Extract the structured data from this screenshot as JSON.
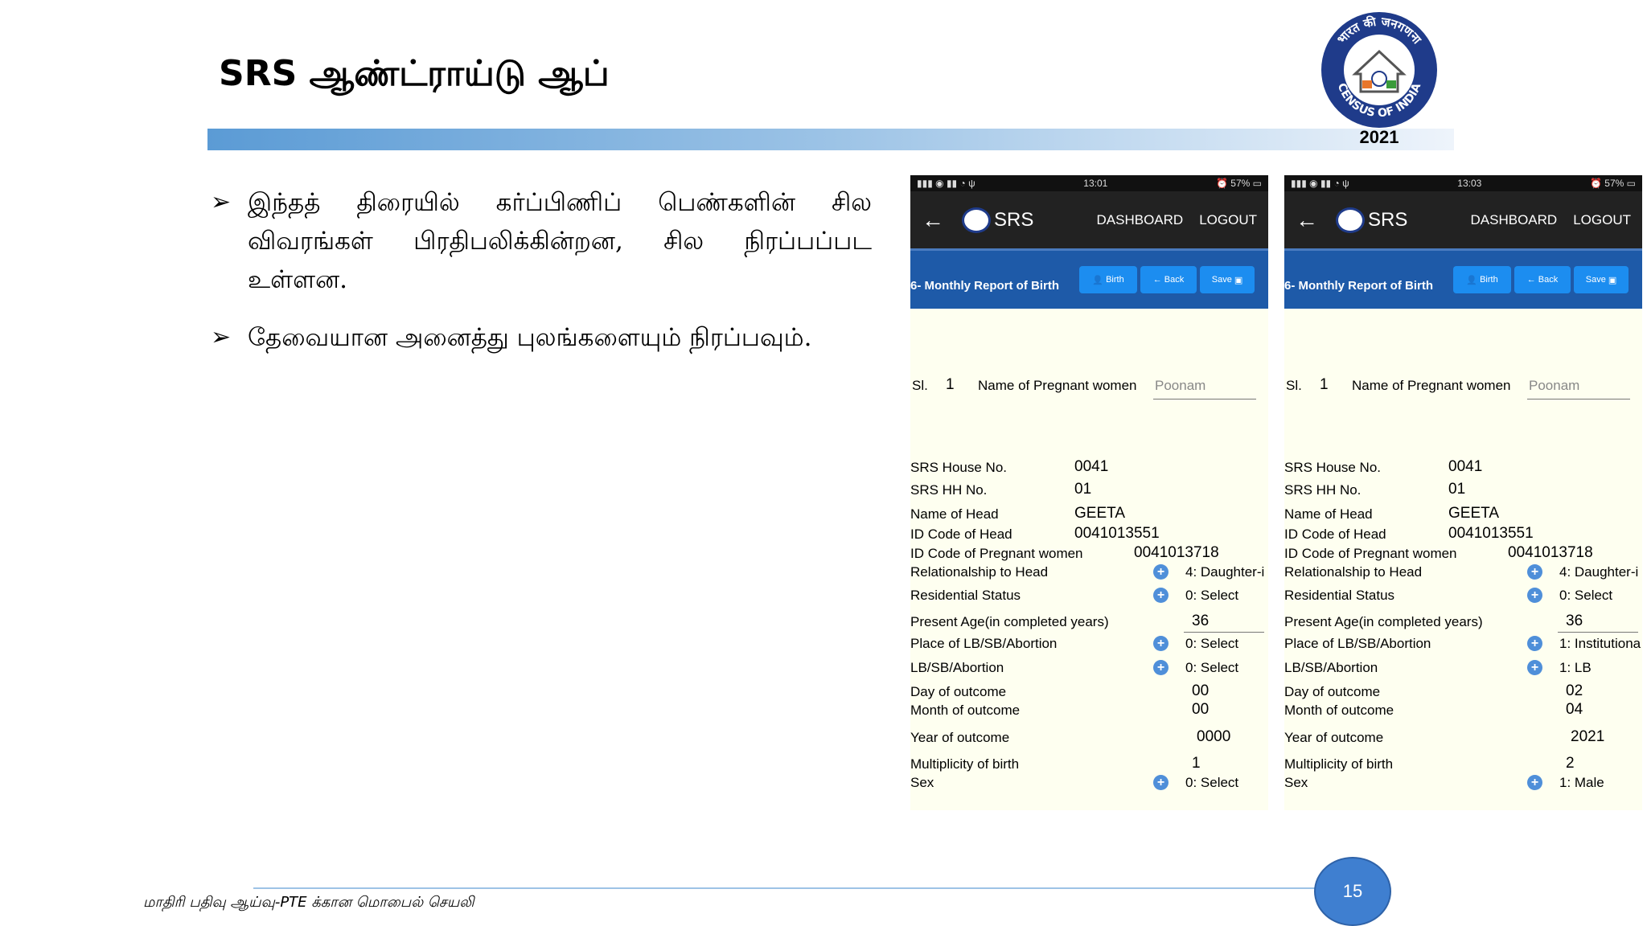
{
  "slide": {
    "title": "SRS ஆண்ட்ராய்டு ஆப்",
    "bullets": [
      "இந்தத் திரையில் கர்ப்பிணிப் பெண்களின் சில விவரங்கள் பிரதிபலிக்கின்றன, சில நிரப்பப்பட உள்ளன.",
      "தேவையான அனைத்து புலங்களையும் நிரப்பவும்."
    ],
    "bullet_symbol": "➢",
    "footer": "மாதிரி பதிவு ஆய்வு-PTE க்கான மொபைல் செயலி",
    "page_number": "15"
  },
  "logo": {
    "top_text": "भारत की जनगणना",
    "bottom_text": "CENSUS OF INDIA",
    "year": "2021",
    "ring_color": "#1f3b8a"
  },
  "colors": {
    "app_bar": "#222222",
    "sub_bar": "#1e5aa8",
    "button": "#1c8df0",
    "form_bg": "#fefff0",
    "accent": "#5b9bd5"
  },
  "phones": [
    {
      "status_time": "13:01",
      "battery": "57%",
      "app_name": "SRS",
      "nav": [
        "DASHBOARD",
        "LOGOUT"
      ],
      "sub_title": "6- Monthly Report of Birth",
      "buttons": [
        "Birth",
        "Back",
        "Save"
      ],
      "sl_label": "Sl.",
      "sl_value": "1",
      "pregnant_name_label": "Name of Pregnant women",
      "pregnant_name_value": "Poonam",
      "house_label": "SRS House No.",
      "house_value": "0041",
      "hh_label": "SRS HH No.",
      "hh_value": "01",
      "head_label": "Name of Head",
      "head_value": "GEETA",
      "idhead_label": "ID Code of Head",
      "idhead_value": "0041013551",
      "idpreg_label": "ID Code of Pregnant women",
      "idpreg_value": "0041013718",
      "rel_label": "Relationalship to Head",
      "rel_value": "4: Daughter-i",
      "res_label": "Residential Status",
      "res_value": "0: Select",
      "age_label": "Present Age(in completed years)",
      "age_value": "36",
      "place_label": "Place of LB/SB/Abortion",
      "place_value": "0: Select",
      "lb_label": "LB/SB/Abortion",
      "lb_value": "0: Select",
      "day_label": "Day of outcome",
      "day_value": "00",
      "month_label": "Month of outcome",
      "month_value": "00",
      "year_label": "Year of outcome",
      "year_value": "0000",
      "mult_label": "Multiplicity of birth",
      "mult_value": "1",
      "sex_label": "Sex",
      "sex_value": "0: Select"
    },
    {
      "status_time": "13:03",
      "battery": "57%",
      "app_name": "SRS",
      "nav": [
        "DASHBOARD",
        "LOGOUT"
      ],
      "sub_title": "6- Monthly Report of Birth",
      "buttons": [
        "Birth",
        "Back",
        "Save"
      ],
      "sl_label": "Sl.",
      "sl_value": "1",
      "pregnant_name_label": "Name of Pregnant women",
      "pregnant_name_value": "Poonam",
      "house_label": "SRS House No.",
      "house_value": "0041",
      "hh_label": "SRS HH No.",
      "hh_value": "01",
      "head_label": "Name of Head",
      "head_value": "GEETA",
      "idhead_label": "ID Code of Head",
      "idhead_value": "0041013551",
      "idpreg_label": "ID Code of Pregnant women",
      "idpreg_value": "0041013718",
      "rel_label": "Relationalship to Head",
      "rel_value": "4: Daughter-i",
      "res_label": "Residential Status",
      "res_value": "0: Select",
      "age_label": "Present Age(in completed years)",
      "age_value": "36",
      "place_label": "Place of LB/SB/Abortion",
      "place_value": "1: Institutiona",
      "lb_label": "LB/SB/Abortion",
      "lb_value": "1: LB",
      "day_label": "Day of outcome",
      "day_value": "02",
      "month_label": "Month of outcome",
      "month_value": "04",
      "year_label": "Year of outcome",
      "year_value": "2021",
      "mult_label": "Multiplicity of birth",
      "mult_value": "2",
      "sex_label": "Sex",
      "sex_value": "1: Male"
    }
  ]
}
